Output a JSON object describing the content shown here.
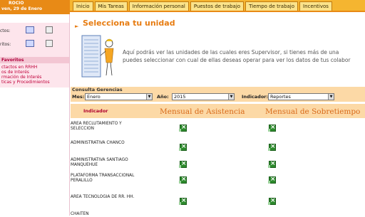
{
  "user": {
    "name": "ROCIO",
    "date": "ven, 29 de Enero"
  },
  "nav": {
    "tabs": [
      "Inicio",
      "Mis Tareas",
      "Información personal",
      "Puestos de trabajo",
      "Tiempo de trabajo",
      "Incentivos"
    ]
  },
  "sidebar": {
    "row1_label": "ctos:",
    "row2_label": "ritos:",
    "favorites_header": "Favoritos",
    "links": [
      "ctactos en RRHH",
      "os de Interés",
      "rmación de Interés",
      "ticas y Procedimientos"
    ]
  },
  "page": {
    "title": "Selecciona tu unidad",
    "intro_line1": "Aquí podrás ver las unidades de las cuales eres Supervisor, si tienes más de una",
    "intro_line2": "puedes seleccionar con cual de ellas deseas operar para ver los datos de tus colabor"
  },
  "filters": {
    "header": "Consulta Gerencias",
    "mes_label": "Mes:",
    "mes_value": "Enero",
    "anio_label": "Año:",
    "anio_value": "2015",
    "indicador_label": "Indicador:",
    "indicador_value": "Reportes"
  },
  "table": {
    "col_indicador": "Indicador",
    "col_asistencia": "Mensual de Asistencia",
    "col_sobretiempo": "Mensual de Sobretiempo",
    "rows": [
      {
        "label": "AREA RECLUTAMIENTO Y SELECCION"
      },
      {
        "label": "ADMINISTRATIVA CHANCO"
      },
      {
        "label": "ADMINISTRATIVA SANTIAGO MANQUEHUE"
      },
      {
        "label": "PLATAFORMA TRANSACCIONAL PERALILLO"
      },
      {
        "label": "AREA TECNOLOGIA DE RR. HH."
      },
      {
        "label": "CHAITEN"
      }
    ]
  },
  "icons": {
    "report": "excel-icon"
  },
  "colors": {
    "accent": "#e77c11",
    "nav": "#f5b530",
    "filter_bg": "#fcd9a6",
    "sidebar_pink": "#fde5ec"
  }
}
